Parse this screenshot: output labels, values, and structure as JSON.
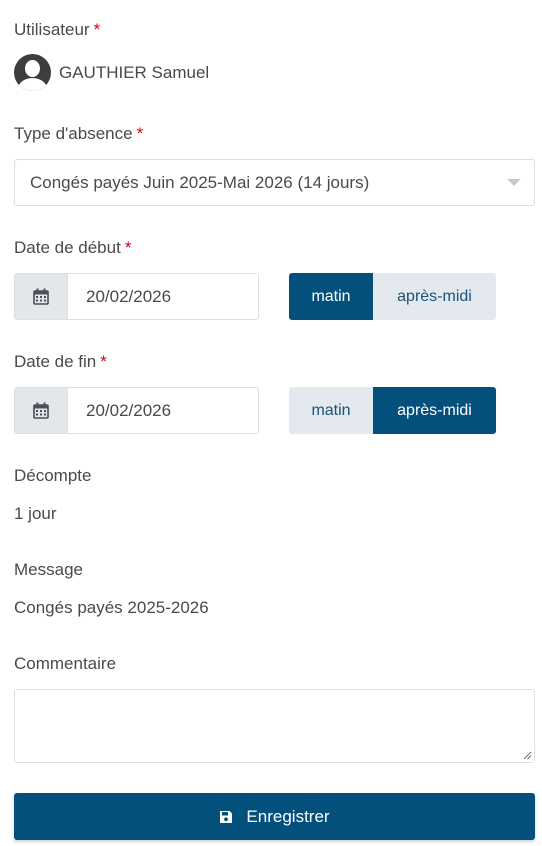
{
  "form": {
    "user": {
      "label": "Utilisateur",
      "required": "*",
      "name": "GAUTHIER Samuel",
      "avatar_icon": "user-avatar-icon"
    },
    "absence_type": {
      "label": "Type d'absence",
      "required": "*",
      "selected": "Congés payés Juin 2025-Mai 2026 (14 jours)"
    },
    "start": {
      "label": "Date de début",
      "required": "*",
      "value": "20/02/2026",
      "icon": "calendar-icon",
      "options": [
        {
          "label": "matin",
          "active": true
        },
        {
          "label": "après-midi",
          "active": false
        }
      ]
    },
    "end": {
      "label": "Date de fin",
      "required": "*",
      "value": "20/02/2026",
      "icon": "calendar-icon",
      "options": [
        {
          "label": "matin",
          "active": false
        },
        {
          "label": "après-midi",
          "active": true
        }
      ]
    },
    "decompte": {
      "label": "Décompte",
      "value": "1 jour"
    },
    "message": {
      "label": "Message",
      "value": "Congés payés 2025-2026"
    },
    "comment": {
      "label": "Commentaire",
      "value": ""
    },
    "save": {
      "label": "Enregistrer",
      "icon": "floppy-disk-icon"
    }
  },
  "colors": {
    "primary": "#03507d",
    "inactive_toggle": "#e3e9ef",
    "required": "#d0021b"
  }
}
